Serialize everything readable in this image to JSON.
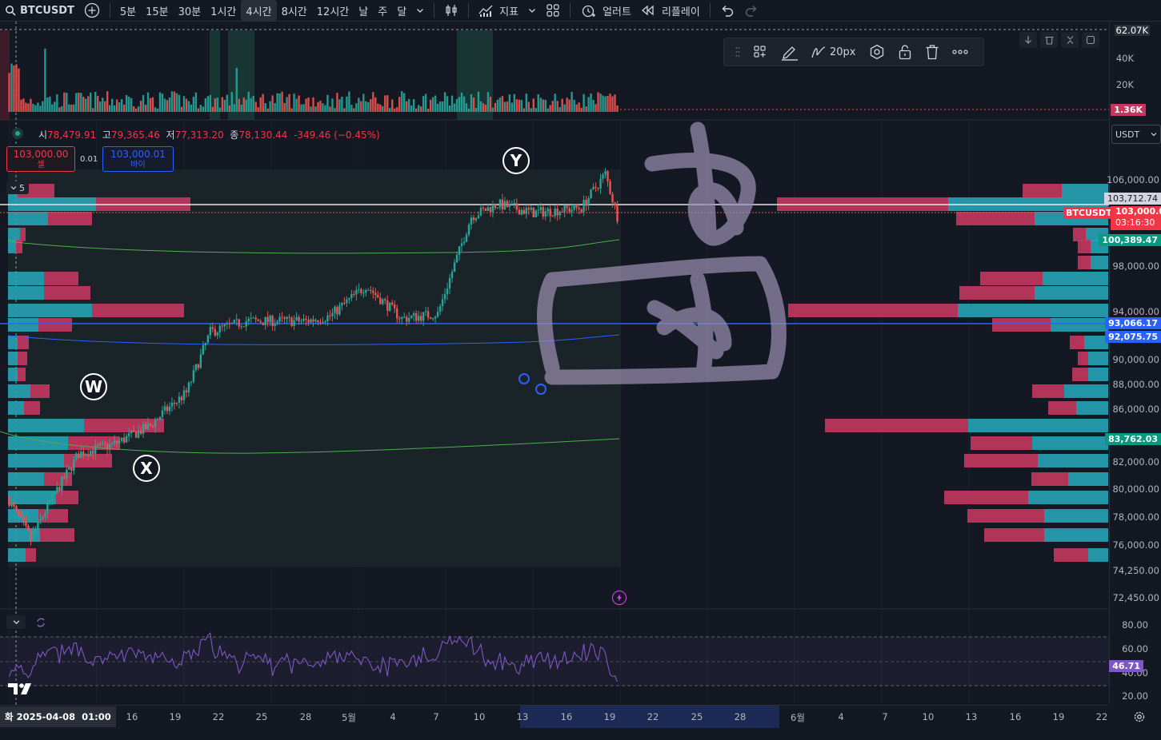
{
  "topbar": {
    "symbol": "BTCUSDT",
    "timeframes": [
      "5분",
      "15분",
      "30분",
      "1시간",
      "4시간",
      "8시간",
      "12시간",
      "날",
      "주",
      "달"
    ],
    "active_timeframe": "4시간",
    "indicators_label": "지표",
    "alert_label": "얼러트",
    "replay_label": "리플레이"
  },
  "ohlc": {
    "open_label": "시",
    "open": "78,479.91",
    "high_label": "고",
    "high": "79,365.46",
    "low_label": "저",
    "low": "77,313.20",
    "close_label": "종",
    "close": "78,130.44",
    "change": "-349.46 (−0.45%)"
  },
  "trade": {
    "sell_price": "103,000.00",
    "sell_label": "셀",
    "spread": "0.01",
    "buy_price": "103,000.01",
    "buy_label": "바이"
  },
  "drawing_toolbar": {
    "width_label": "20px"
  },
  "currency_select": "USDT",
  "collapse_count": "5",
  "volume_axis": {
    "labels": [
      "62.07K",
      "40K",
      "20K"
    ],
    "current_volume": "1.36K"
  },
  "price_axis": {
    "labels": [
      "106,000.00",
      "98,000.00",
      "94,000.00",
      "90,000.00",
      "88,000.00",
      "86,000.00",
      "82,000.00",
      "80,000.00",
      "78,000.00",
      "76,000.00",
      "74,250.00",
      "72,450.00"
    ],
    "line_price": "103,712.74",
    "last_price": "103,000.00",
    "countdown": "03:16:30",
    "symbol_tag": "BTCUSDT",
    "green_price_1": "100,389.47",
    "blue_price_1": "93,066.17",
    "blue_price_2": "92,075.75",
    "green_price_2": "83,762.03"
  },
  "rsi_axis": {
    "labels": [
      "80.00",
      "60.00",
      "40.00",
      "20.00"
    ],
    "current": "46.71"
  },
  "time_axis": {
    "current": "화 2025-04-08  01:00",
    "labels": [
      "16",
      "19",
      "22",
      "25",
      "28",
      "5월",
      "4",
      "7",
      "10",
      "13",
      "16",
      "19",
      "22",
      "25",
      "28",
      "6월",
      "4",
      "7",
      "10",
      "13",
      "16",
      "19",
      "22"
    ]
  },
  "wave_labels": {
    "w": "W",
    "x": "X",
    "y": "Y"
  },
  "colors": {
    "background": "#141823",
    "up": "#26a69a",
    "down": "#ef5350",
    "vp_up": "#26a3b5",
    "vp_down": "#c4375f",
    "rsi": "#7e57c2",
    "blue_line": "#2962ff",
    "green_line": "#4caf50"
  }
}
